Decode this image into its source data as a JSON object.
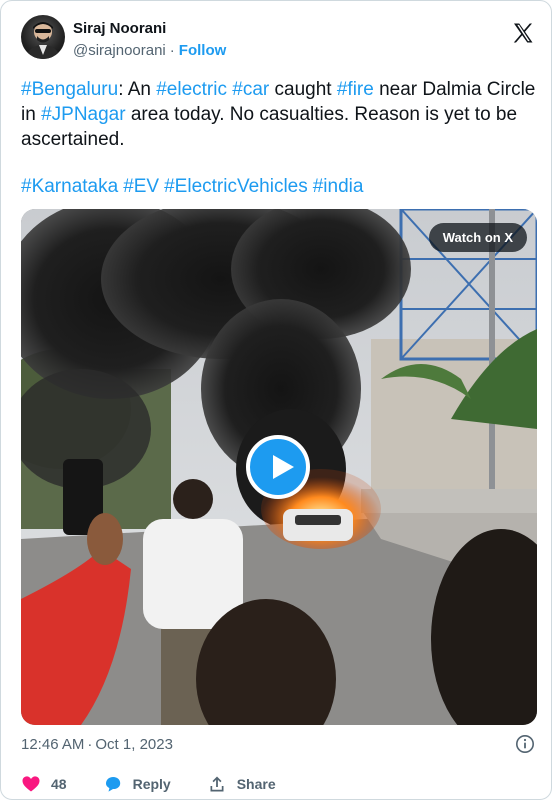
{
  "author": {
    "display_name": "Siraj Noorani",
    "handle": "@sirajnoorani",
    "separator": "·",
    "follow_label": "Follow"
  },
  "tweet": {
    "segments": [
      {
        "text": "#Bengaluru",
        "tag": true
      },
      {
        "text": ": An ",
        "tag": false
      },
      {
        "text": "#electric",
        "tag": true
      },
      {
        "text": " ",
        "tag": false
      },
      {
        "text": "#car",
        "tag": true
      },
      {
        "text": " caught ",
        "tag": false
      },
      {
        "text": "#fire",
        "tag": true
      },
      {
        "text": " near Dalmia Circle in ",
        "tag": false
      },
      {
        "text": "#JPNagar",
        "tag": true
      },
      {
        "text": " area today. No casualties. Reason is yet to be ascertained.",
        "tag": false
      }
    ],
    "hashtags": [
      "#Karnataka",
      "#EV",
      "#ElectricVehicles",
      "#india"
    ]
  },
  "media": {
    "watch_label": "Watch on X",
    "play_icon": "play-icon"
  },
  "meta": {
    "time": "12:46 AM",
    "separator": "·",
    "date": "Oct 1, 2023"
  },
  "actions": {
    "like_count": "48",
    "reply_label": "Reply",
    "share_label": "Share"
  },
  "colors": {
    "accent": "#1d9bf0",
    "like": "#f91880",
    "text": "#0f1419",
    "muted": "#536471",
    "border": "#cfd9de"
  }
}
